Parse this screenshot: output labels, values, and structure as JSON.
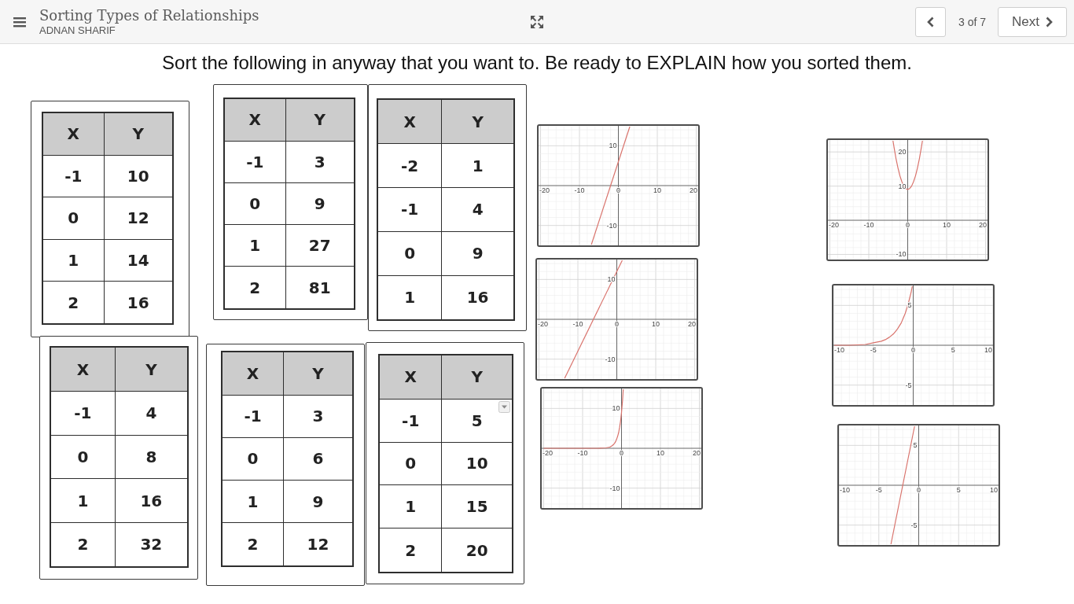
{
  "header": {
    "title": "Sorting Types of Relationships",
    "author": "ADNAN SHARIF",
    "page_indicator": "3 of 7",
    "next_label": "Next"
  },
  "instructions": "Sort the following in anyway that you want to. Be ready to EXPLAIN how you sorted them.",
  "cards": [
    {
      "kind": "table",
      "columns": [
        "X",
        "Y"
      ],
      "rows": [
        [
          "-1",
          "10"
        ],
        [
          "0",
          "12"
        ],
        [
          "1",
          "14"
        ],
        [
          "2",
          "16"
        ]
      ],
      "dropdown": false
    },
    {
      "kind": "table",
      "columns": [
        "X",
        "Y"
      ],
      "rows": [
        [
          "-1",
          "3"
        ],
        [
          "0",
          "9"
        ],
        [
          "1",
          "27"
        ],
        [
          "2",
          "81"
        ]
      ],
      "dropdown": false
    },
    {
      "kind": "table",
      "columns": [
        "X",
        "Y"
      ],
      "rows": [
        [
          "-2",
          "1"
        ],
        [
          "-1",
          "4"
        ],
        [
          "0",
          "9"
        ],
        [
          "1",
          "16"
        ]
      ],
      "dropdown": false
    },
    {
      "kind": "table",
      "columns": [
        "X",
        "Y"
      ],
      "rows": [
        [
          "-1",
          "4"
        ],
        [
          "0",
          "8"
        ],
        [
          "1",
          "16"
        ],
        [
          "2",
          "32"
        ]
      ],
      "dropdown": false
    },
    {
      "kind": "table",
      "columns": [
        "X",
        "Y"
      ],
      "rows": [
        [
          "-1",
          "3"
        ],
        [
          "0",
          "6"
        ],
        [
          "1",
          "9"
        ],
        [
          "2",
          "12"
        ]
      ],
      "dropdown": false
    },
    {
      "kind": "table",
      "columns": [
        "X",
        "Y"
      ],
      "rows": [
        [
          "-1",
          "5"
        ],
        [
          "0",
          "10"
        ],
        [
          "1",
          "15"
        ],
        [
          "2",
          "20"
        ]
      ],
      "dropdown": true
    },
    {
      "kind": "graph",
      "chart_data": {
        "type": "line",
        "x": [
          -7,
          3
        ],
        "series": [
          {
            "color": "#d9736c",
            "values": [
              -15,
              15
            ]
          }
        ],
        "xlim": [
          -20.5,
          20.5
        ],
        "ylim": [
          -15,
          15
        ],
        "xticks": [
          -20,
          -10,
          0,
          10,
          20
        ],
        "yticks": [
          -10,
          10
        ],
        "grid": true
      }
    },
    {
      "kind": "graph",
      "chart_data": {
        "type": "line",
        "x": [
          -13.5,
          1.5
        ],
        "series": [
          {
            "color": "#d9736c",
            "values": [
              -15,
              15
            ]
          }
        ],
        "xlim": [
          -20.5,
          20.5
        ],
        "ylim": [
          -15,
          15
        ],
        "xticks": [
          -20,
          -10,
          0,
          10,
          20
        ],
        "yticks": [
          -10,
          10
        ],
        "grid": true
      }
    },
    {
      "kind": "graph",
      "chart_data": {
        "type": "line",
        "x": [
          -20,
          -6,
          -4,
          -3.5,
          -3,
          -2.5,
          -2,
          -1.75,
          -1.5,
          -1.25,
          -1,
          -0.75,
          -0.5,
          -0.25,
          0,
          0.25,
          0.45
        ],
        "series": [
          {
            "color": "#d9736c",
            "values": [
              0,
              0,
              0.1,
              0.2,
              0.3,
              0.6,
              1,
              1.3,
              1.7,
              2.3,
              3,
              3.9,
              5.2,
              6.8,
              9,
              11.8,
              14.8
            ]
          }
        ],
        "xlim": [
          -20.5,
          20.5
        ],
        "ylim": [
          -15,
          15
        ],
        "xticks": [
          -20,
          -10,
          0,
          10,
          20
        ],
        "yticks": [
          -10,
          10
        ],
        "grid": true
      }
    },
    {
      "kind": "graph",
      "chart_data": {
        "type": "line",
        "x": [
          -3.8,
          -3.5,
          -3,
          -2.5,
          -2,
          -1.5,
          -1,
          -0.5,
          0,
          0.5,
          1,
          1.5,
          2,
          2.5,
          3,
          3.5,
          3.8
        ],
        "series": [
          {
            "color": "#d9736c",
            "values": [
              23.4,
              21.3,
              18,
              15.3,
              13,
              11.3,
              10,
              9.3,
              9,
              9.3,
              10,
              11.3,
              13,
              15.3,
              18,
              21.3,
              23.4
            ]
          }
        ],
        "xlim": [
          -20.5,
          20.5
        ],
        "ylim": [
          -11.5,
          23.5
        ],
        "xticks": [
          -20,
          -10,
          0,
          10,
          20
        ],
        "yticks": [
          -10,
          10,
          20
        ],
        "grid": true
      }
    },
    {
      "kind": "graph",
      "chart_data": {
        "type": "line",
        "x": [
          -10,
          -8,
          -6,
          -5,
          -4.5,
          -4,
          -3.5,
          -3,
          -2.5,
          -2.25,
          -2,
          -1.75,
          -1.5,
          -1.25,
          -1,
          -0.75,
          -0.5,
          -0.25,
          -0.1
        ],
        "series": [
          {
            "color": "#d9736c",
            "values": [
              0,
              0,
              0.1,
              0.3,
              0.4,
              0.5,
              0.7,
              1,
              1.4,
              1.7,
              2,
              2.4,
              2.8,
              3.4,
              4,
              4.8,
              5.7,
              6.7,
              7.5
            ]
          }
        ],
        "xlim": [
          -10,
          10
        ],
        "ylim": [
          -7.5,
          7.5
        ],
        "xticks": [
          -10,
          -5,
          0,
          5,
          10
        ],
        "yticks": [
          -5,
          5
        ],
        "grid": true
      }
    },
    {
      "kind": "graph",
      "chart_data": {
        "type": "line",
        "x": [
          -3.5,
          -0.5
        ],
        "series": [
          {
            "color": "#d9736c",
            "values": [
              -7.5,
              7.5
            ]
          }
        ],
        "xlim": [
          -10,
          10
        ],
        "ylim": [
          -7.5,
          7.5
        ],
        "xticks": [
          -10,
          -5,
          0,
          5,
          10
        ],
        "yticks": [
          -5,
          5
        ],
        "grid": true
      }
    }
  ]
}
